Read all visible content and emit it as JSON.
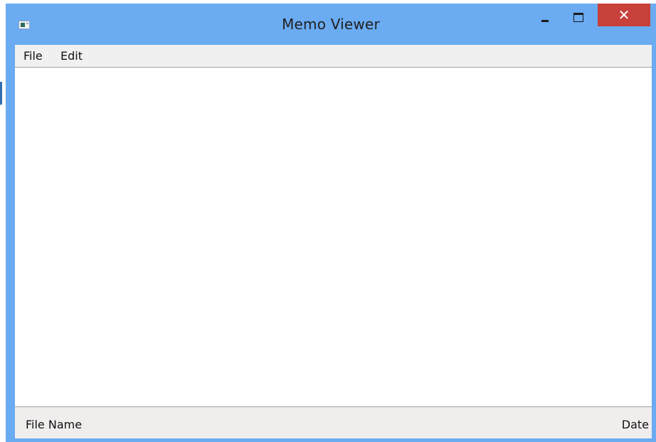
{
  "window": {
    "title": "Memo Viewer",
    "icon": "app-window-icon",
    "controls": {
      "minimize_icon": "minimize-icon",
      "maximize_icon": "maximize-icon",
      "close_label": "✕"
    }
  },
  "menubar": {
    "items": [
      {
        "label": "File"
      },
      {
        "label": "Edit"
      }
    ]
  },
  "statusbar": {
    "left": "File Name",
    "right": "Date"
  },
  "colors": {
    "titlebar": "#6aabf2",
    "close_button": "#c7403a",
    "menubar": "#f0f0f0",
    "statusbar": "#f0eded"
  }
}
